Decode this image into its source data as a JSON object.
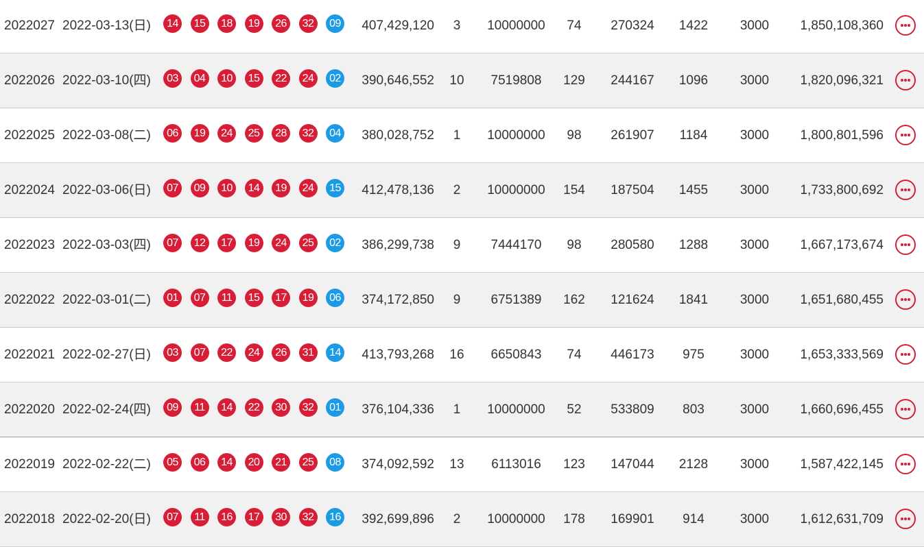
{
  "colors": {
    "red_ball": "#d81e36",
    "blue_ball": "#1c9be4",
    "alt_row": "#f1f1f1",
    "more_button": "#d81e36"
  },
  "rows": [
    {
      "issue": "2022027",
      "date": "2022-03-13(日)",
      "red": [
        "14",
        "15",
        "18",
        "19",
        "26",
        "32"
      ],
      "blue": "09",
      "sales": "407,429,120",
      "n1": "3",
      "p1": "10000000",
      "n2": "74",
      "p2": "270324",
      "n3": "1422",
      "p3": "3000",
      "pool": "1,850,108,360"
    },
    {
      "issue": "2022026",
      "date": "2022-03-10(四)",
      "red": [
        "03",
        "04",
        "10",
        "15",
        "22",
        "24"
      ],
      "blue": "02",
      "sales": "390,646,552",
      "n1": "10",
      "p1": "7519808",
      "n2": "129",
      "p2": "244167",
      "n3": "1096",
      "p3": "3000",
      "pool": "1,820,096,321"
    },
    {
      "issue": "2022025",
      "date": "2022-03-08(二)",
      "red": [
        "06",
        "19",
        "24",
        "25",
        "28",
        "32"
      ],
      "blue": "04",
      "sales": "380,028,752",
      "n1": "1",
      "p1": "10000000",
      "n2": "98",
      "p2": "261907",
      "n3": "1184",
      "p3": "3000",
      "pool": "1,800,801,596"
    },
    {
      "issue": "2022024",
      "date": "2022-03-06(日)",
      "red": [
        "07",
        "09",
        "10",
        "14",
        "19",
        "24"
      ],
      "blue": "15",
      "sales": "412,478,136",
      "n1": "2",
      "p1": "10000000",
      "n2": "154",
      "p2": "187504",
      "n3": "1455",
      "p3": "3000",
      "pool": "1,733,800,692"
    },
    {
      "issue": "2022023",
      "date": "2022-03-03(四)",
      "red": [
        "07",
        "12",
        "17",
        "19",
        "24",
        "25"
      ],
      "blue": "02",
      "sales": "386,299,738",
      "n1": "9",
      "p1": "7444170",
      "n2": "98",
      "p2": "280580",
      "n3": "1288",
      "p3": "3000",
      "pool": "1,667,173,674"
    },
    {
      "issue": "2022022",
      "date": "2022-03-01(二)",
      "red": [
        "01",
        "07",
        "11",
        "15",
        "17",
        "19"
      ],
      "blue": "06",
      "sales": "374,172,850",
      "n1": "9",
      "p1": "6751389",
      "n2": "162",
      "p2": "121624",
      "n3": "1841",
      "p3": "3000",
      "pool": "1,651,680,455"
    },
    {
      "issue": "2022021",
      "date": "2022-02-27(日)",
      "red": [
        "03",
        "07",
        "22",
        "24",
        "26",
        "31"
      ],
      "blue": "14",
      "sales": "413,793,268",
      "n1": "16",
      "p1": "6650843",
      "n2": "74",
      "p2": "446173",
      "n3": "975",
      "p3": "3000",
      "pool": "1,653,333,569"
    },
    {
      "issue": "2022020",
      "date": "2022-02-24(四)",
      "red": [
        "09",
        "11",
        "14",
        "22",
        "30",
        "32"
      ],
      "blue": "01",
      "sales": "376,104,336",
      "n1": "1",
      "p1": "10000000",
      "n2": "52",
      "p2": "533809",
      "n3": "803",
      "p3": "3000",
      "pool": "1,660,696,455"
    },
    {
      "issue": "2022019",
      "date": "2022-02-22(二)",
      "red": [
        "05",
        "06",
        "14",
        "20",
        "21",
        "25"
      ],
      "blue": "08",
      "sales": "374,092,592",
      "n1": "13",
      "p1": "6113016",
      "n2": "123",
      "p2": "147044",
      "n3": "2128",
      "p3": "3000",
      "pool": "1,587,422,145"
    },
    {
      "issue": "2022018",
      "date": "2022-02-20(日)",
      "red": [
        "07",
        "11",
        "16",
        "17",
        "30",
        "32"
      ],
      "blue": "16",
      "sales": "392,699,896",
      "n1": "2",
      "p1": "10000000",
      "n2": "178",
      "p2": "169901",
      "n3": "914",
      "p3": "3000",
      "pool": "1,612,631,709"
    }
  ],
  "icons": {
    "more": "more-options-icon"
  }
}
